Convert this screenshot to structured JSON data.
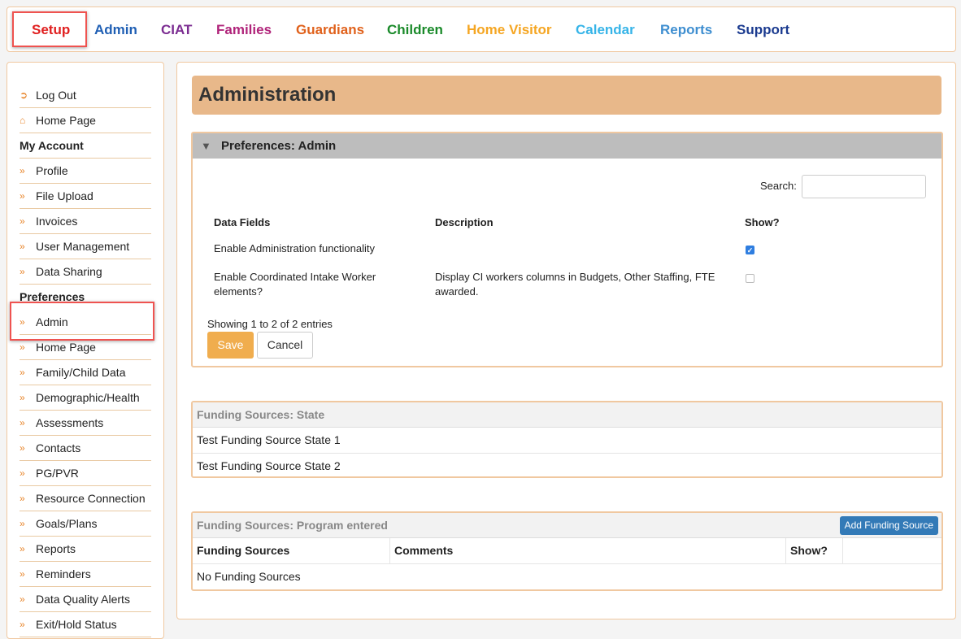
{
  "nav": {
    "items": [
      {
        "label": "Setup",
        "color": "#e02020"
      },
      {
        "label": "Admin",
        "color": "#1f5fb4"
      },
      {
        "label": "CIAT",
        "color": "#7b2c91"
      },
      {
        "label": "Families",
        "color": "#b0247a"
      },
      {
        "label": "Guardians",
        "color": "#e0611b"
      },
      {
        "label": "Children",
        "color": "#1a8a2a"
      },
      {
        "label": "Home Visitor",
        "color": "#f5a623"
      },
      {
        "label": "Calendar",
        "color": "#36b4e8"
      },
      {
        "label": "Reports",
        "color": "#3e8ed0"
      },
      {
        "label": "Support",
        "color": "#1a3a8f"
      }
    ],
    "active": "Setup"
  },
  "sidebar": {
    "top": [
      {
        "label": "Log Out",
        "icon": "sign-out-icon"
      },
      {
        "label": "Home Page",
        "icon": "home-icon"
      }
    ],
    "my_account_heading": "My Account",
    "my_account": [
      "Profile",
      "File Upload",
      "Invoices",
      "User Management",
      "Data Sharing"
    ],
    "preferences_heading": "Preferences",
    "preferences": [
      "Admin",
      "Home Page",
      "Family/Child Data",
      "Demographic/Health",
      "Assessments",
      "Contacts",
      "PG/PVR",
      "Resource Connection",
      "Goals/Plans",
      "Reports",
      "Reminders",
      "Data Quality Alerts",
      "Exit/Hold Status"
    ],
    "active": "Admin"
  },
  "main": {
    "title": "Administration",
    "preferences_panel": {
      "title": "Preferences: Admin",
      "search_label": "Search:",
      "search_value": "",
      "headers": [
        "Data Fields",
        "Description",
        "Show?"
      ],
      "rows": [
        {
          "field": "Enable Administration functionality",
          "description": "",
          "show": true
        },
        {
          "field_line1": "Enable Coordinated Intake Worker",
          "field_line2": "elements?",
          "description_line1": "Display CI workers columns in Budgets, Other Staffing, FTE",
          "description_line2": "awarded.",
          "show": false
        }
      ],
      "info": "Showing 1 to 2 of 2 entries",
      "save_label": "Save",
      "cancel_label": "Cancel"
    },
    "state_panel": {
      "title": "Funding Sources: State",
      "rows": [
        "Test Funding Source State 1",
        "Test Funding Source State 2"
      ]
    },
    "program_panel": {
      "title": "Funding Sources: Program entered",
      "add_label": "Add Funding Source",
      "headers": [
        "Funding Sources",
        "Comments",
        "Show?"
      ],
      "empty": "No Funding Sources"
    }
  }
}
